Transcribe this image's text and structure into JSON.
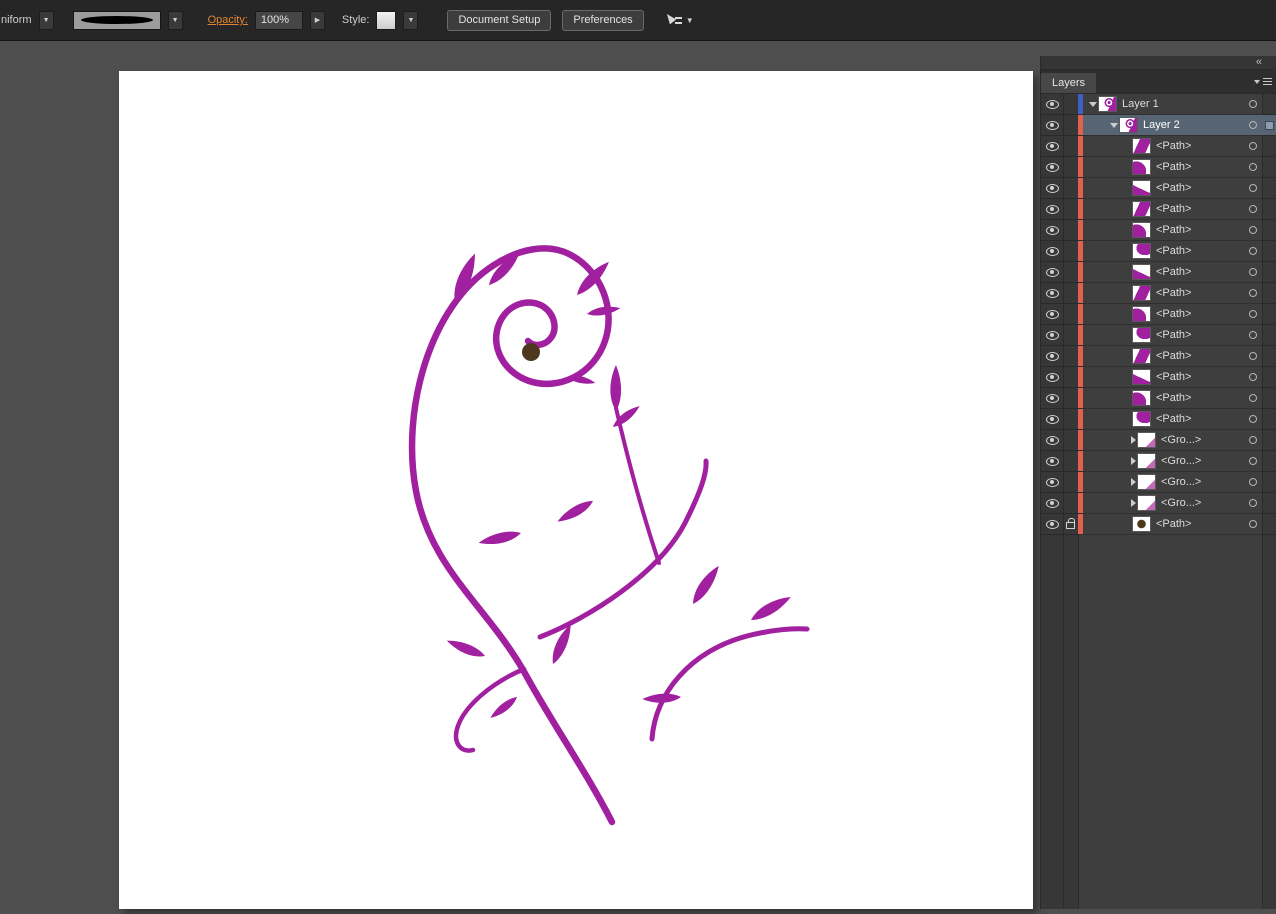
{
  "toolbar": {
    "profile_label": "niform",
    "opacity_label": "Opacity:",
    "opacity_value": "100%",
    "style_label": "Style:",
    "document_setup": "Document Setup",
    "preferences": "Preferences"
  },
  "panel": {
    "tab": "Layers",
    "collapse_icon": "«",
    "rows": [
      {
        "label": "Layer 1",
        "kind": "layer",
        "indent": 0,
        "twirl": "down",
        "bar": "blue",
        "thumb": "floral",
        "selected": false,
        "locked": false
      },
      {
        "label": "Layer 2",
        "kind": "layer",
        "indent": 1,
        "twirl": "down",
        "bar": "salmon",
        "thumb": "floral",
        "selected": true,
        "locked": false
      },
      {
        "label": "<Path>",
        "kind": "path",
        "indent": 2,
        "twirl": "none",
        "bar": "salmon",
        "thumb": "w1",
        "selected": false,
        "locked": false
      },
      {
        "label": "<Path>",
        "kind": "path",
        "indent": 2,
        "twirl": "none",
        "bar": "salmon",
        "thumb": "w2",
        "selected": false,
        "locked": false
      },
      {
        "label": "<Path>",
        "kind": "path",
        "indent": 2,
        "twirl": "none",
        "bar": "salmon",
        "thumb": "w3",
        "selected": false,
        "locked": false
      },
      {
        "label": "<Path>",
        "kind": "path",
        "indent": 2,
        "twirl": "none",
        "bar": "salmon",
        "thumb": "w1",
        "selected": false,
        "locked": false
      },
      {
        "label": "<Path>",
        "kind": "path",
        "indent": 2,
        "twirl": "none",
        "bar": "salmon",
        "thumb": "w2",
        "selected": false,
        "locked": false
      },
      {
        "label": "<Path>",
        "kind": "path",
        "indent": 2,
        "twirl": "none",
        "bar": "salmon",
        "thumb": "w4",
        "selected": false,
        "locked": false
      },
      {
        "label": "<Path>",
        "kind": "path",
        "indent": 2,
        "twirl": "none",
        "bar": "salmon",
        "thumb": "w3",
        "selected": false,
        "locked": false
      },
      {
        "label": "<Path>",
        "kind": "path",
        "indent": 2,
        "twirl": "none",
        "bar": "salmon",
        "thumb": "w1",
        "selected": false,
        "locked": false
      },
      {
        "label": "<Path>",
        "kind": "path",
        "indent": 2,
        "twirl": "none",
        "bar": "salmon",
        "thumb": "w2",
        "selected": false,
        "locked": false
      },
      {
        "label": "<Path>",
        "kind": "path",
        "indent": 2,
        "twirl": "none",
        "bar": "salmon",
        "thumb": "w4",
        "selected": false,
        "locked": false
      },
      {
        "label": "<Path>",
        "kind": "path",
        "indent": 2,
        "twirl": "none",
        "bar": "salmon",
        "thumb": "w1",
        "selected": false,
        "locked": false
      },
      {
        "label": "<Path>",
        "kind": "path",
        "indent": 2,
        "twirl": "none",
        "bar": "salmon",
        "thumb": "w3",
        "selected": false,
        "locked": false
      },
      {
        "label": "<Path>",
        "kind": "path",
        "indent": 2,
        "twirl": "none",
        "bar": "salmon",
        "thumb": "w2",
        "selected": false,
        "locked": false
      },
      {
        "label": "<Path>",
        "kind": "path",
        "indent": 2,
        "twirl": "none",
        "bar": "salmon",
        "thumb": "w4",
        "selected": false,
        "locked": false
      },
      {
        "label": "<Gro...>",
        "kind": "group",
        "indent": 2,
        "twirl": "right",
        "bar": "salmon",
        "thumb": "group",
        "selected": false,
        "locked": false
      },
      {
        "label": "<Gro...>",
        "kind": "group",
        "indent": 2,
        "twirl": "right",
        "bar": "salmon",
        "thumb": "group",
        "selected": false,
        "locked": false
      },
      {
        "label": "<Gro...>",
        "kind": "group",
        "indent": 2,
        "twirl": "right",
        "bar": "salmon",
        "thumb": "group",
        "selected": false,
        "locked": false
      },
      {
        "label": "<Gro...>",
        "kind": "group",
        "indent": 2,
        "twirl": "right",
        "bar": "salmon",
        "thumb": "group",
        "selected": false,
        "locked": false
      },
      {
        "label": "<Path>",
        "kind": "path",
        "indent": 2,
        "twirl": "none",
        "bar": "salmon",
        "thumb": "brown",
        "selected": false,
        "locked": true
      }
    ]
  },
  "colors": {
    "magenta": "#a1209f",
    "brown": "#4e381d",
    "layer1_bar": "#3f5fc8",
    "layer_bar": "#e2604e",
    "selection": "#566474"
  }
}
